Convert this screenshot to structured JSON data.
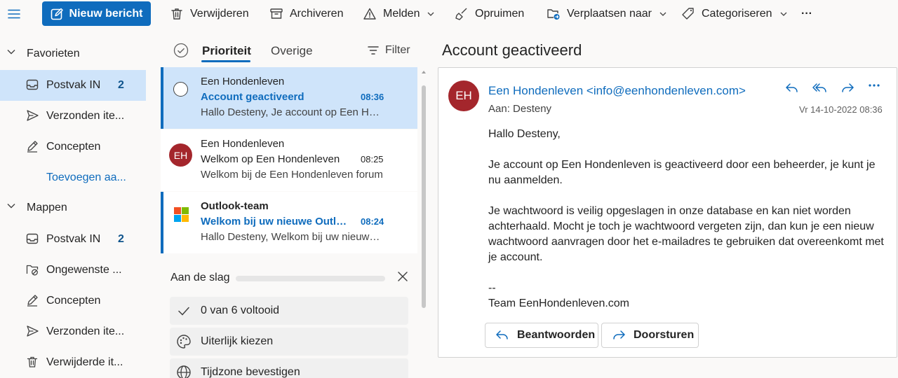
{
  "toolbar": {
    "new_message": "Nieuw bericht",
    "delete": "Verwijderen",
    "archive": "Archiveren",
    "report": "Melden",
    "sweep": "Opruimen",
    "move_to": "Verplaatsen naar",
    "categorize": "Categoriseren",
    "more": "···"
  },
  "nav": {
    "favorites": {
      "label": "Favorieten",
      "items": [
        {
          "label": "Postvak IN",
          "count": "2"
        },
        {
          "label": "Verzonden ite..."
        },
        {
          "label": "Concepten"
        }
      ],
      "add_link": "Toevoegen aa..."
    },
    "folders": {
      "label": "Mappen",
      "items": [
        {
          "label": "Postvak IN",
          "count": "2"
        },
        {
          "label": "Ongewenste ..."
        },
        {
          "label": "Concepten"
        },
        {
          "label": "Verzonden ite..."
        },
        {
          "label": "Verwijderde it..."
        }
      ]
    }
  },
  "list": {
    "tabs": [
      "Prioriteit",
      "Overige"
    ],
    "filter": "Filter",
    "messages": [
      {
        "from": "Een Hondenleven",
        "subject": "Account geactiveerd",
        "time": "08:36",
        "preview": "Hallo Desteny, Je account op Een Hondenleven is geactiveerd"
      },
      {
        "from": "Een Hondenleven",
        "initials": "EH",
        "subject": "Welkom op Een Hondenleven",
        "time": "08:25",
        "preview": "Welkom bij de Een Hondenleven forum"
      },
      {
        "from": "Outlook-team",
        "subject": "Welkom bij uw nieuwe Outlook.com-account",
        "time": "08:24",
        "preview": "Hallo Desteny, Welkom bij uw nieuwe account"
      }
    ],
    "get_started": {
      "title": "Aan de slag",
      "items": [
        "0 van 6 voltooid",
        "Uiterlijk kiezen",
        "Tijdzone bevestigen"
      ]
    }
  },
  "reading": {
    "subject": "Account geactiveerd",
    "avatar_initials": "EH",
    "sender": "Een Hondenleven <info@eenhondenleven.com>",
    "to": "Aan:  Desteny",
    "date": "Vr 14-10-2022 08:36",
    "body": {
      "greeting": "Hallo Desteny,",
      "p1": "Je account op Een Hondenleven is geactiveerd door een beheerder, je kunt je nu aanmelden.",
      "p2": "Je wachtwoord is veilig opgeslagen in onze database en kan niet worden achterhaald. Mocht je toch je wachtwoord vergeten zijn, dan kun je een nieuw wachtwoord aanvragen door het e-mailadres te gebruiken dat overeenkomt met je account.",
      "sig1": "--",
      "sig2": "Team EenHondenleven.com"
    },
    "reply": "Beantwoorden",
    "forward": "Doorsturen"
  },
  "colors": {
    "accent": "#0f6cbd",
    "selected": "#cfe4fa",
    "avatar": "#a4262c"
  }
}
